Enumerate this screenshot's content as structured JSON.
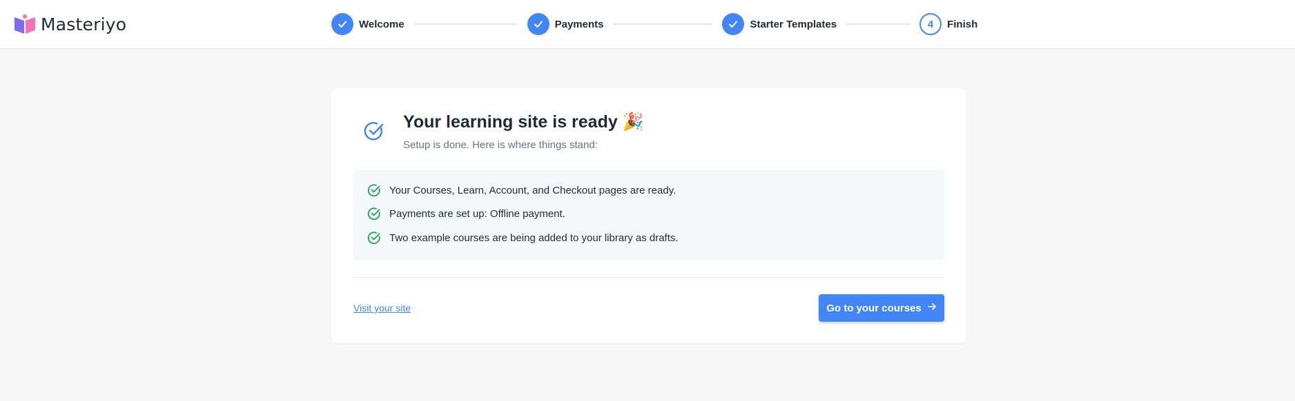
{
  "brand": {
    "name": "Masteriyo",
    "logo_icon": "book-logo-icon",
    "colors": {
      "purple": "#7c6cf2",
      "pink": "#f472b6"
    }
  },
  "stepper": {
    "accent": "#4285f4",
    "steps": [
      {
        "label": "Welcome",
        "state": "done",
        "icon": "check-icon"
      },
      {
        "label": "Payments",
        "state": "done",
        "icon": "check-icon"
      },
      {
        "label": "Starter Templates",
        "state": "done",
        "icon": "check-icon"
      },
      {
        "label": "Finish",
        "state": "current",
        "number": "4"
      }
    ]
  },
  "card": {
    "title": "Your learning site is ready",
    "title_emoji": "🎉",
    "subtitle": "Setup is done. Here is where things stand:",
    "header_icon": "circle-check-icon",
    "status_items": [
      {
        "text": "Your Courses, Learn, Account, and Checkout pages are ready.",
        "icon": "circle-check-icon"
      },
      {
        "text": "Payments are set up: Offline payment.",
        "icon": "circle-check-icon"
      },
      {
        "text": "Two example courses are being added to your library as drafts.",
        "icon": "circle-check-icon"
      }
    ],
    "status_color": "#16a34a",
    "secondary_link": "Visit your site",
    "primary_button": "Go to your courses",
    "primary_button_icon": "arrow-right-icon"
  }
}
